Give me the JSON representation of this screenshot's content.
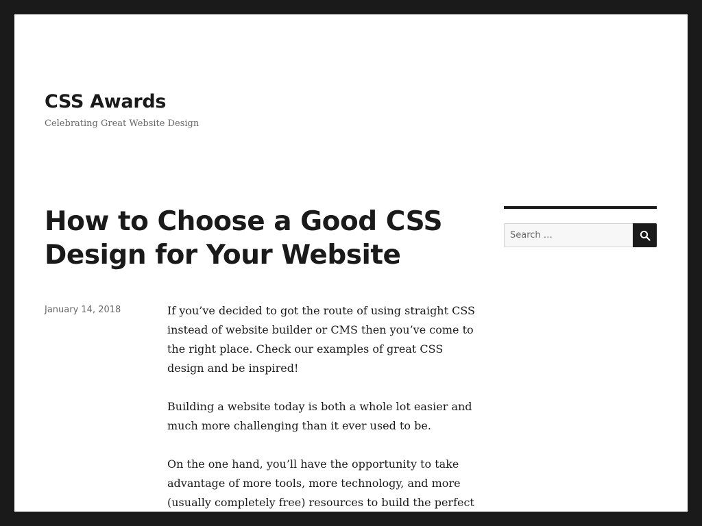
{
  "site": {
    "title": "CSS Awards",
    "description": "Celebrating Great Website Design"
  },
  "post": {
    "title": "How to Choose a Good CSS Design for Your Website",
    "date": "January 14, 2018",
    "paragraphs": [
      "If you’ve decided to got the route of using straight CSS instead of website builder or CMS then you’ve come to the right place.  Check our examples of great CSS design and be inspired!",
      "Building a website today is both a whole lot easier and much more challenging than it ever used to be.",
      "On the one hand, you’ll have the opportunity to take advantage of more tools, more technology, and more (usually completely free) resources to build the perfect"
    ]
  },
  "sidebar": {
    "search": {
      "placeholder": "Search …",
      "value": "",
      "icon": "search-icon"
    }
  },
  "colors": {
    "frame": "#1a1a1a",
    "background": "#ffffff",
    "text": "#1a1a1a",
    "muted": "#686868"
  }
}
